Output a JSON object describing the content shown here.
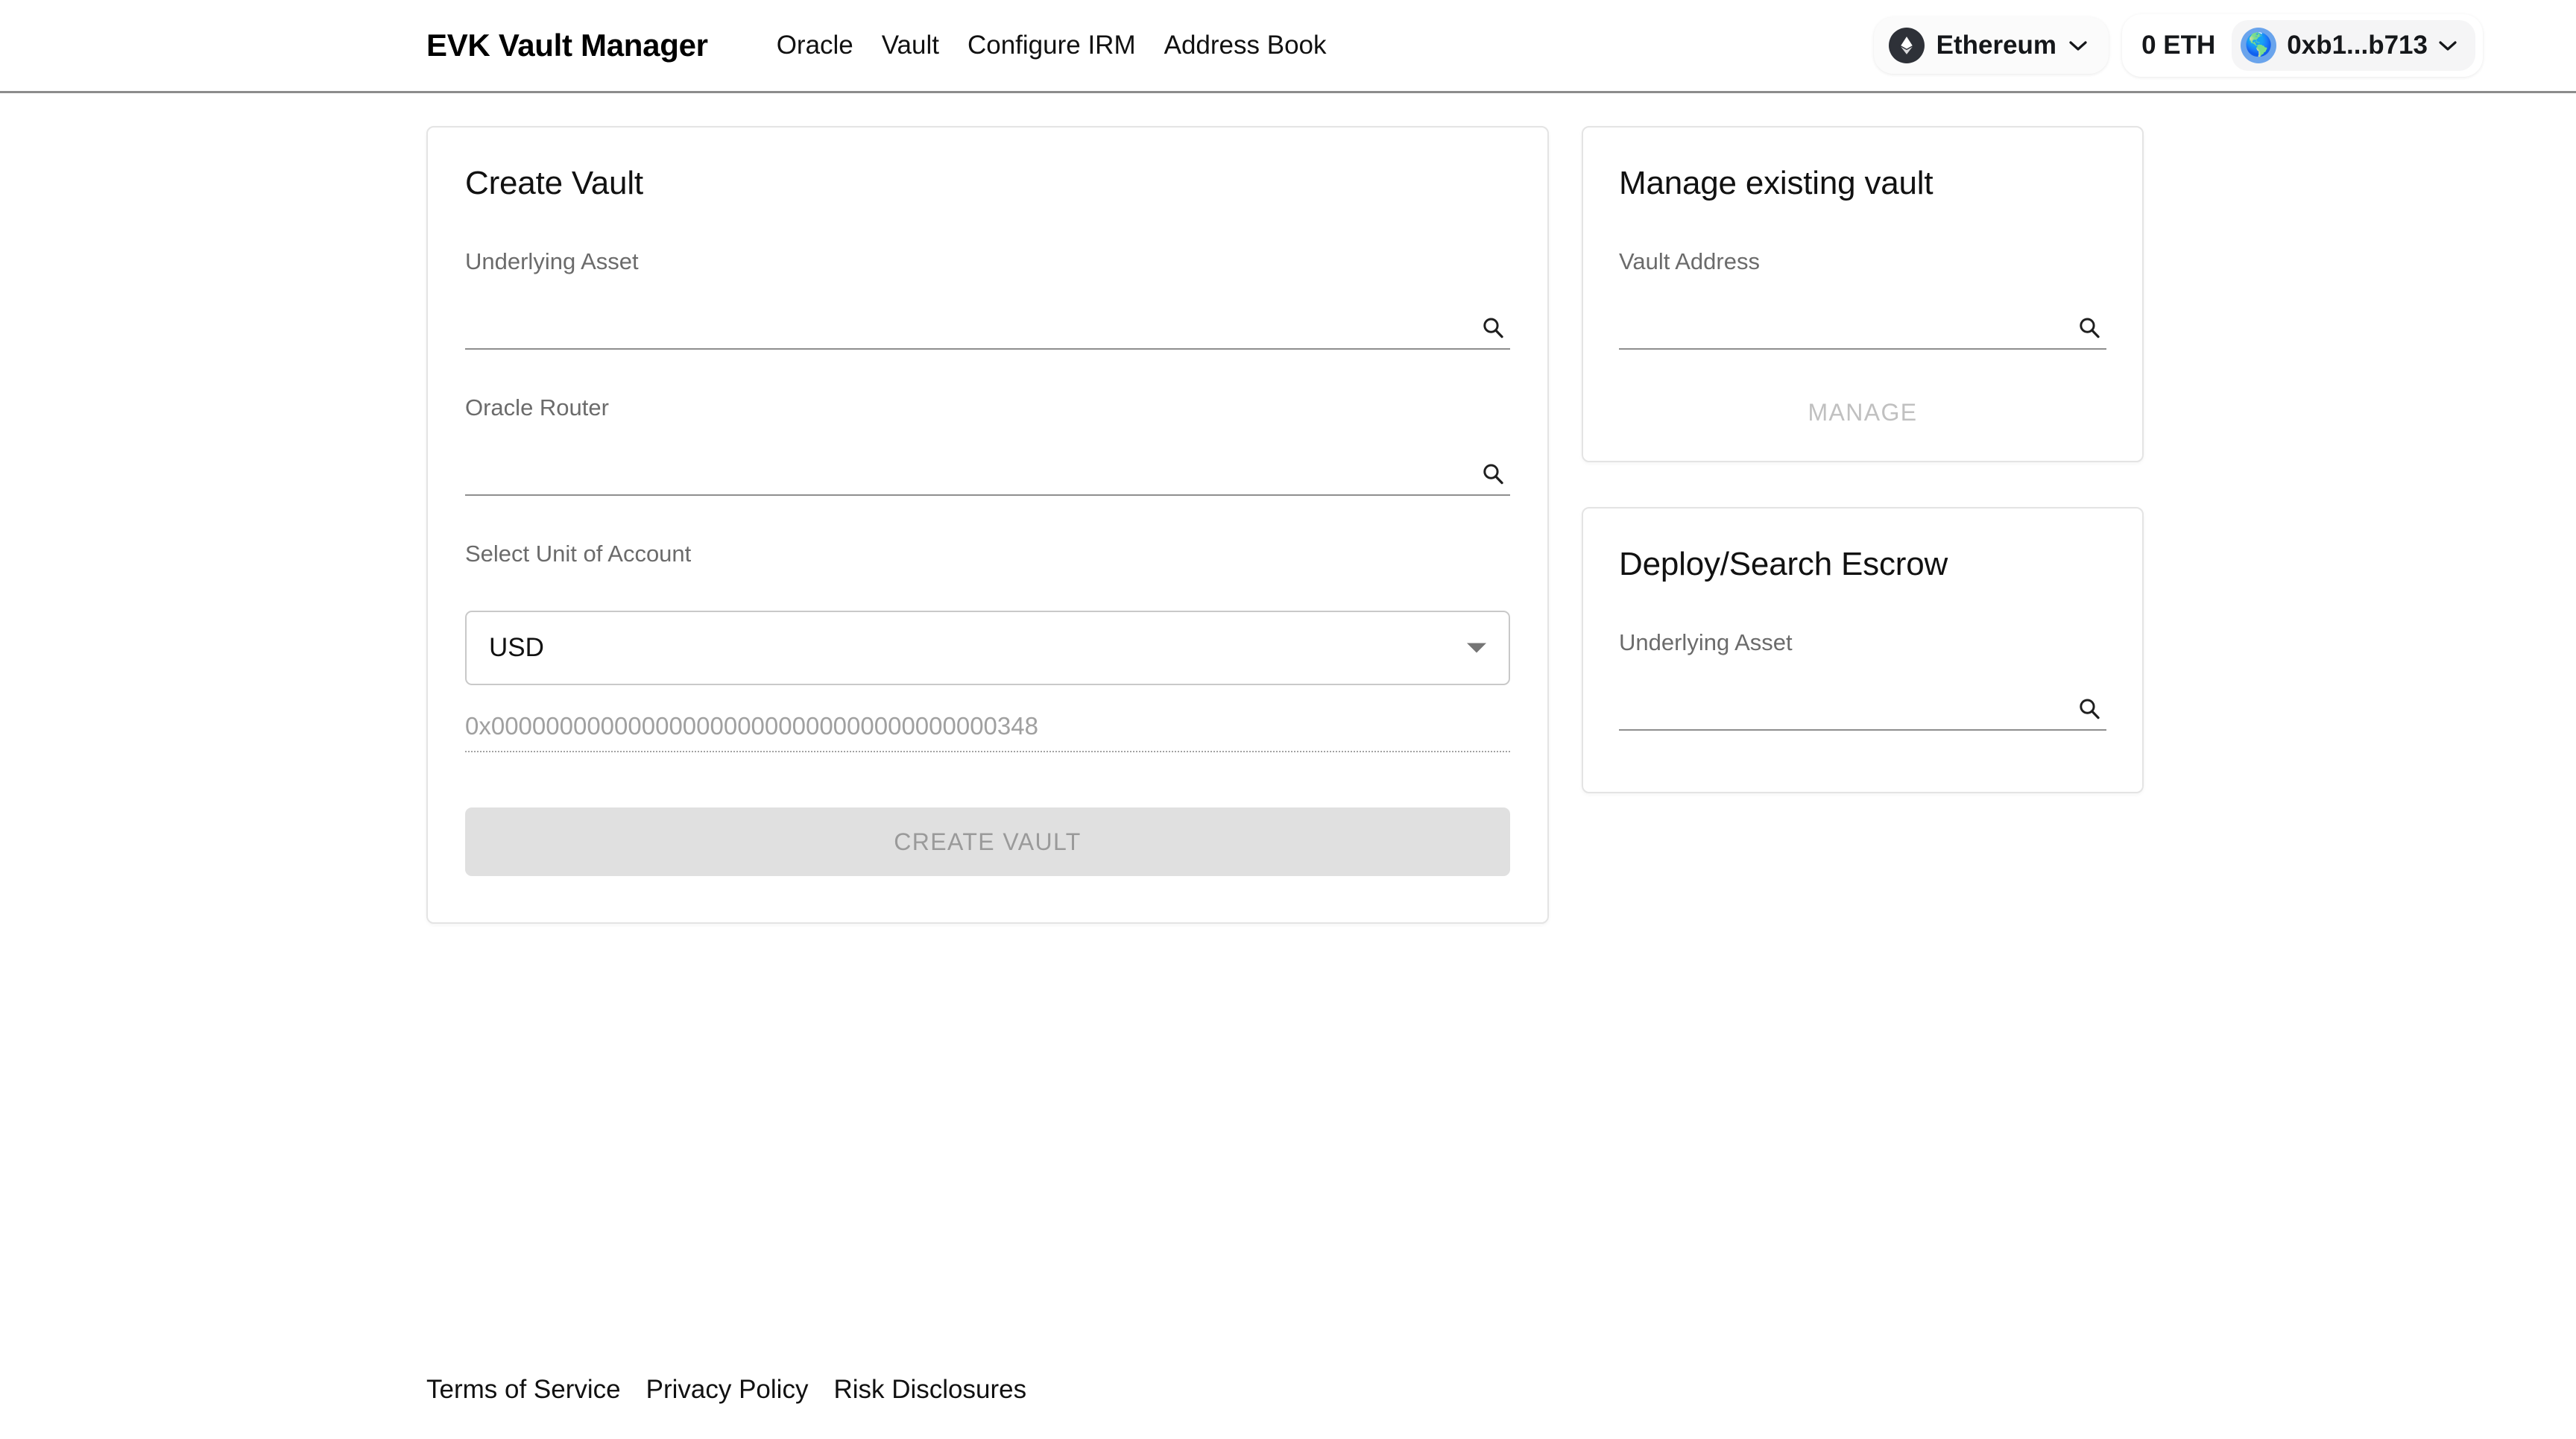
{
  "header": {
    "brand": "EVK Vault Manager",
    "nav": [
      {
        "label": "Oracle"
      },
      {
        "label": "Vault"
      },
      {
        "label": "Configure IRM"
      },
      {
        "label": "Address Book"
      }
    ],
    "chain": {
      "name": "Ethereum",
      "icon": "ethereum-logo-icon",
      "chevron": "chevron-down-icon"
    },
    "wallet": {
      "balance": "0 ETH",
      "address": "0xb1...b713",
      "avatar_glyph": "🌎",
      "chevron": "chevron-down-icon"
    }
  },
  "create_vault": {
    "title": "Create Vault",
    "underlying_asset": {
      "label": "Underlying Asset",
      "value": "",
      "placeholder": "",
      "icon": "search-icon"
    },
    "oracle_router": {
      "label": "Oracle Router",
      "value": "",
      "placeholder": "",
      "icon": "search-icon"
    },
    "unit_of_account": {
      "label": "Select Unit of Account",
      "value": "USD",
      "options": [
        "USD"
      ],
      "arrow": "chevron-down-icon"
    },
    "unit_address": "0x0000000000000000000000000000000000000348",
    "submit_label": "CREATE VAULT"
  },
  "manage_vault": {
    "title": "Manage existing vault",
    "vault_address": {
      "label": "Vault Address",
      "value": "",
      "placeholder": "",
      "icon": "search-icon"
    },
    "button_label": "MANAGE"
  },
  "escrow": {
    "title": "Deploy/Search Escrow",
    "underlying_asset": {
      "label": "Underlying Asset",
      "value": "",
      "placeholder": "",
      "icon": "search-icon"
    }
  },
  "footer": {
    "links": [
      {
        "label": "Terms of Service"
      },
      {
        "label": "Privacy Policy"
      },
      {
        "label": "Risk Disclosures"
      }
    ]
  },
  "colors": {
    "accent_dark": "#2e3138",
    "avatar_blue": "#6aa4ec",
    "disabled_button_bg": "#e0e0e0",
    "border_gray": "#e4e4e4",
    "label_gray": "#6b6b6b"
  }
}
